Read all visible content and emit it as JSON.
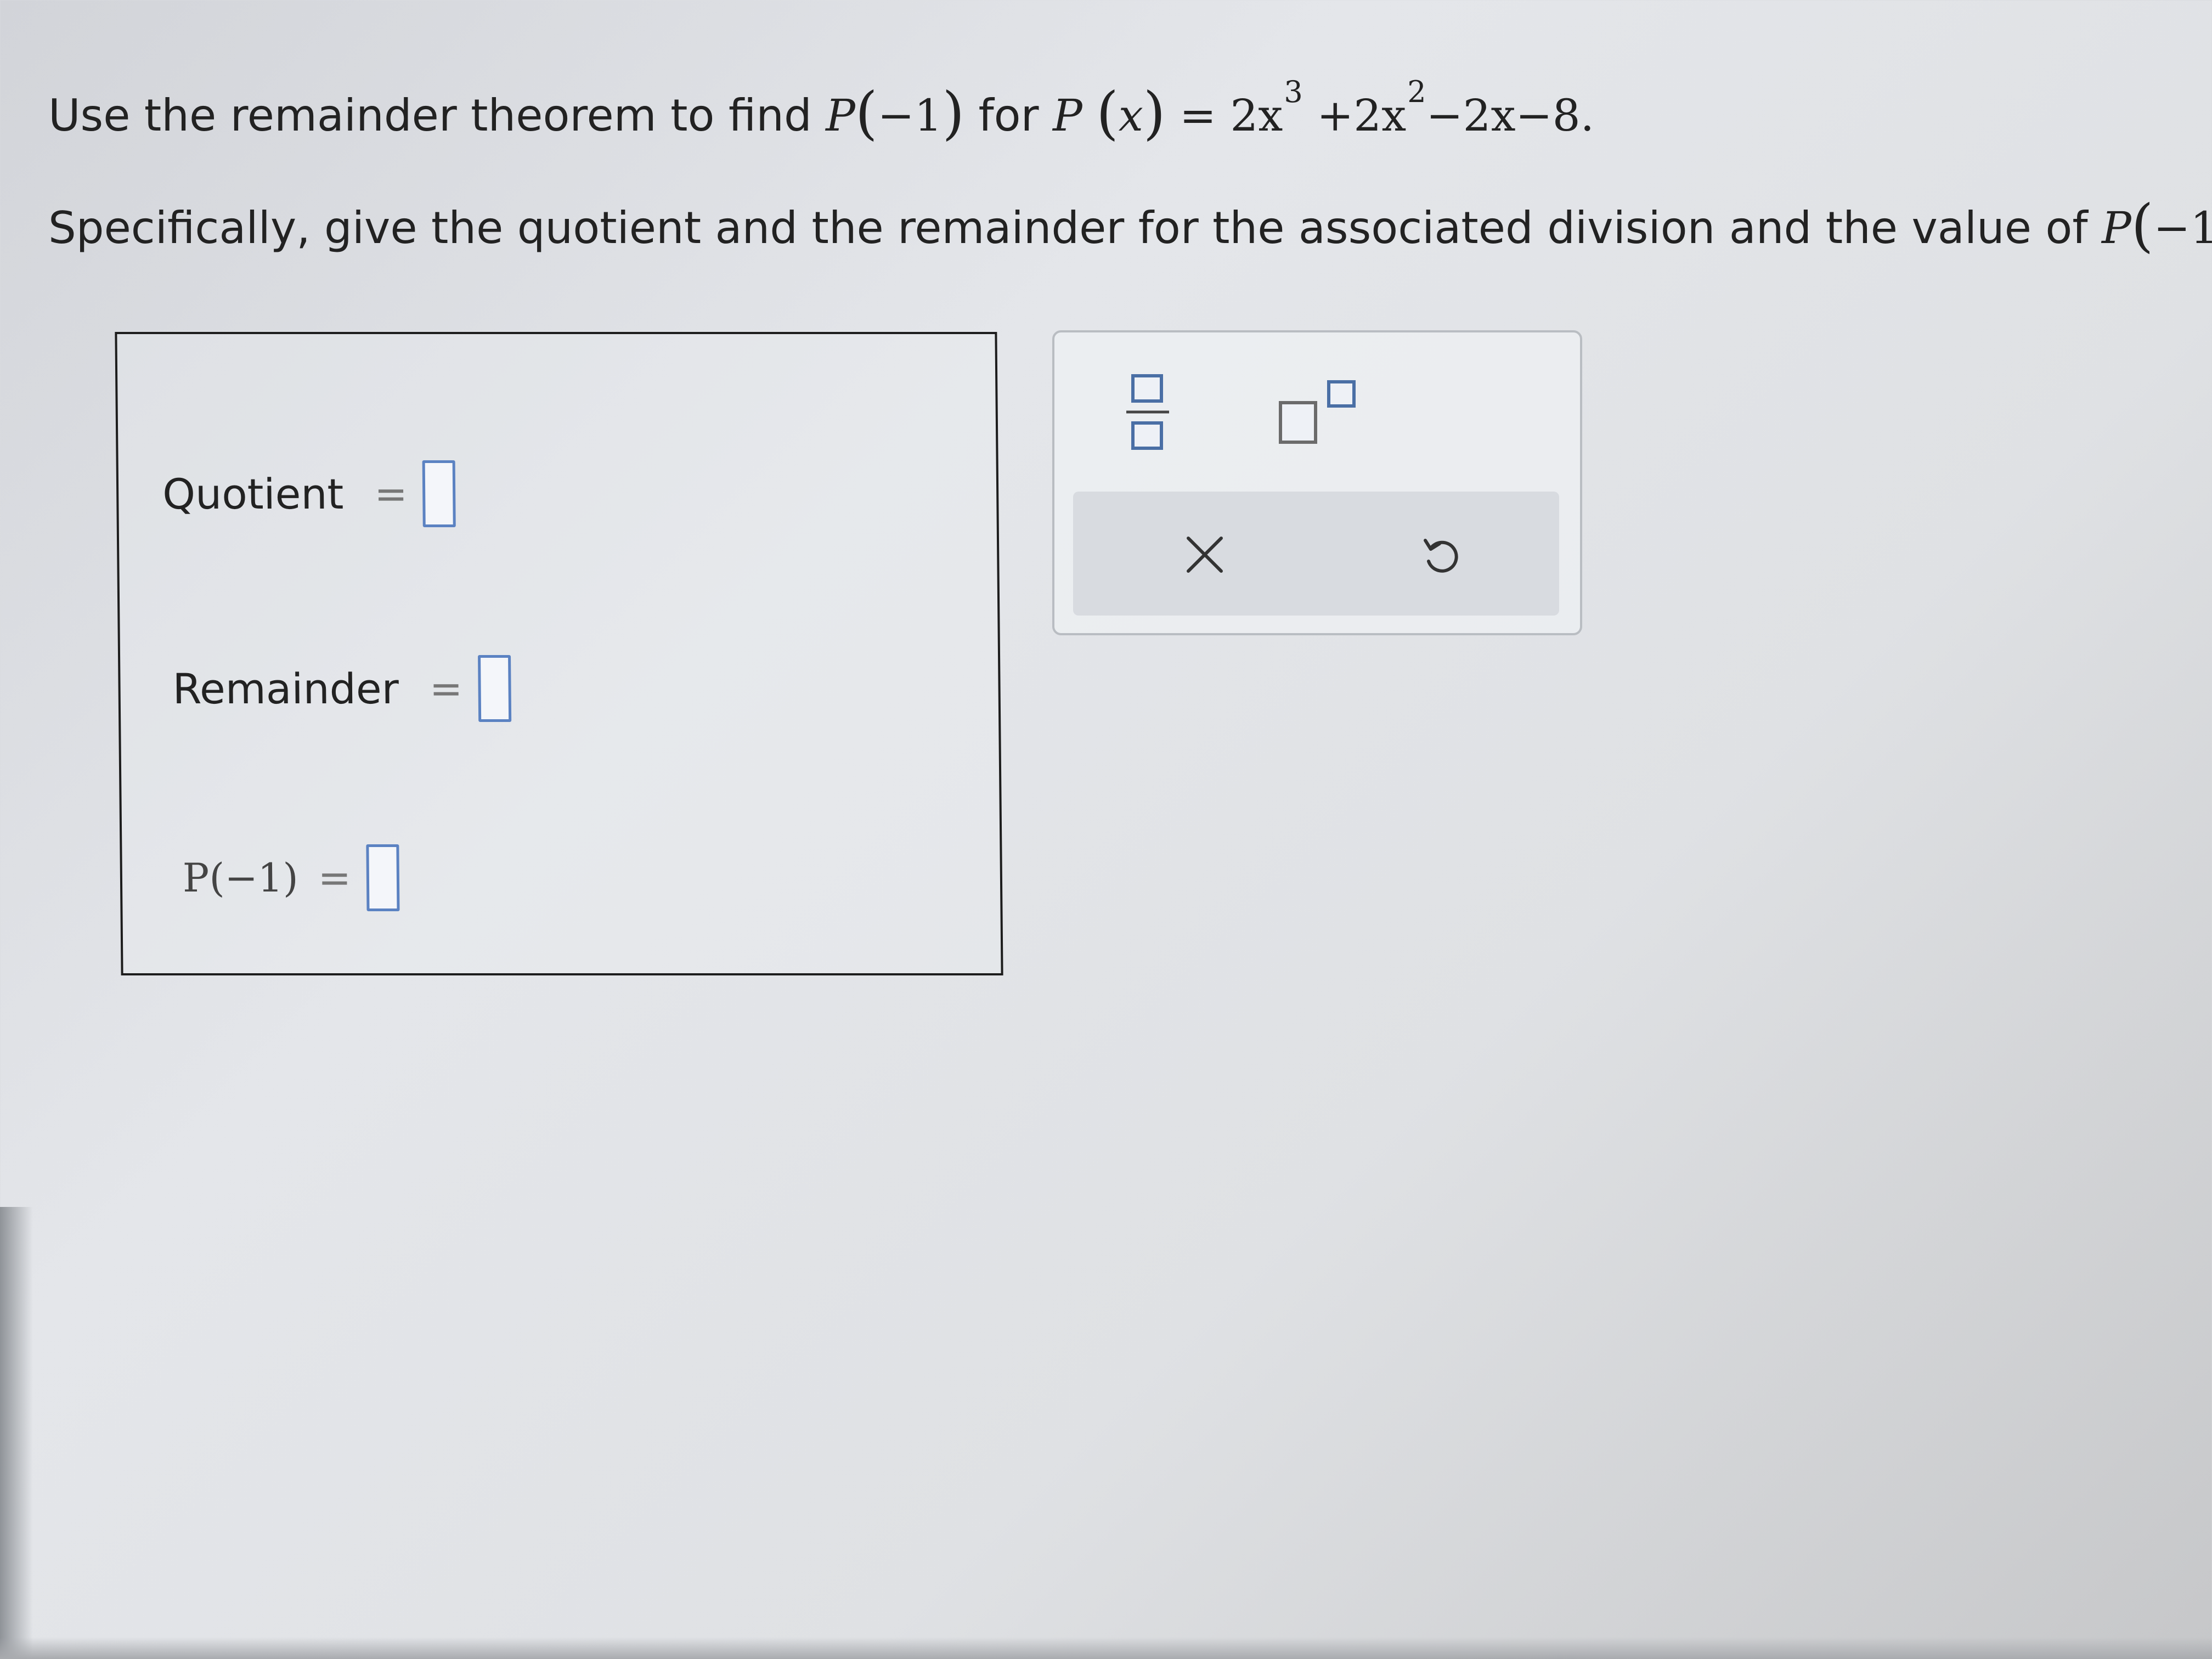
{
  "question": {
    "line1_text": "Use the remainder theorem to find",
    "line1_for": "for",
    "p_neg1": {
      "func": "P",
      "arg": "−1"
    },
    "px": {
      "func": "P",
      "var": "x"
    },
    "polynomial": {
      "eq": "=",
      "c1": "2x",
      "e1": "3",
      "op1": "+",
      "c2": "2x",
      "e2": "2",
      "rest": "−2x−8."
    },
    "line2_text": "Specifically, give the quotient and the remainder for the associated division and the value of",
    "line2_end": "."
  },
  "answers": {
    "quotient": {
      "label": "Quotient",
      "eq": "=",
      "value": ""
    },
    "remainder": {
      "label": "Remainder",
      "eq": "=",
      "value": ""
    },
    "p_neg1": {
      "label": "P(−1)",
      "eq": "=",
      "value": ""
    }
  },
  "toolbar": {
    "icons": [
      "fraction-icon",
      "exponent-icon",
      "clear-icon",
      "undo-icon"
    ],
    "accent_color": "#4a6fa5"
  }
}
